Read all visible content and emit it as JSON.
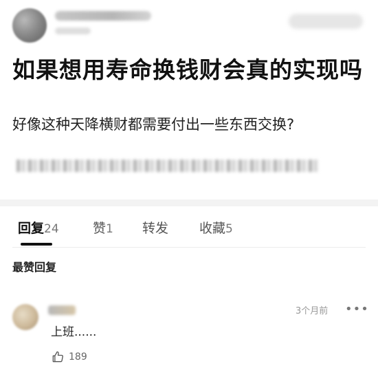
{
  "post": {
    "title": "如果想用寿命换钱财会真的实现吗",
    "body": "好像这种天降横财都需要付出一些东西交换?"
  },
  "tabs": [
    {
      "label": "回复",
      "count": "24",
      "active": true
    },
    {
      "label": "赞",
      "count": "1",
      "active": false
    },
    {
      "label": "转发",
      "count": "",
      "active": false
    },
    {
      "label": "收藏",
      "count": "5",
      "active": false
    }
  ],
  "section_label": "最赞回复",
  "comment": {
    "time": "3个月前",
    "more": "•••",
    "text": "上班......",
    "likes": "189"
  },
  "icons": {
    "avatar": "user-avatar-blurred",
    "more": "more-dots-icon",
    "like": "thumbs-up-icon"
  }
}
